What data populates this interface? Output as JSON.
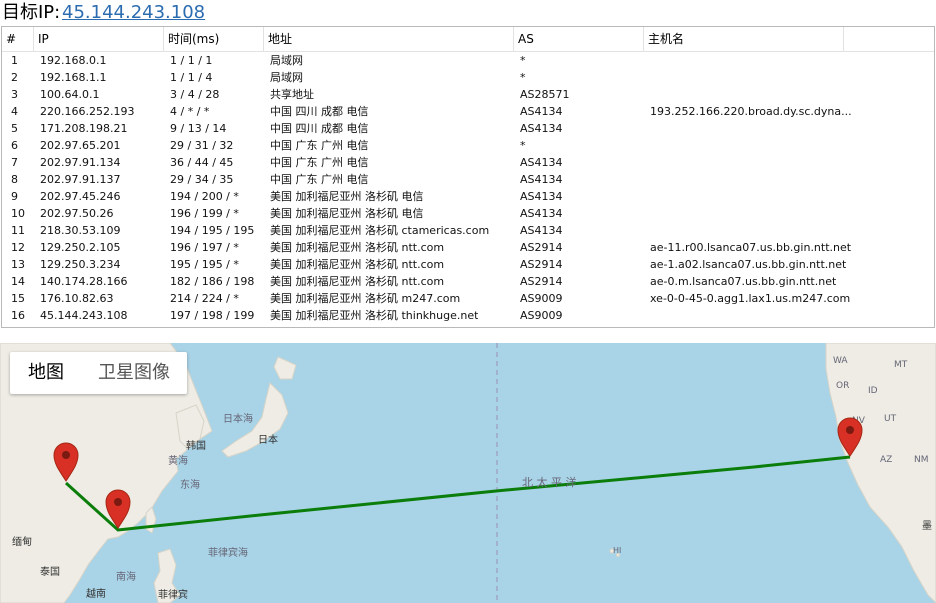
{
  "header": {
    "label": "目标IP:",
    "ip": "45.144.243.108"
  },
  "table": {
    "columns": [
      "#",
      "IP",
      "时间(ms)",
      "地址",
      "AS",
      "主机名"
    ],
    "rows": [
      [
        "1",
        "192.168.0.1",
        "1 / 1 / 1",
        "局域网",
        "*",
        ""
      ],
      [
        "2",
        "192.168.1.1",
        "1 / 1 / 4",
        "局域网",
        "*",
        ""
      ],
      [
        "3",
        "100.64.0.1",
        "3 / 4 / 28",
        "共享地址",
        "AS28571",
        ""
      ],
      [
        "4",
        "220.166.252.193",
        "4 / * / *",
        "中国 四川 成都 电信",
        "AS4134",
        "193.252.166.220.broad.dy.sc.dyna..."
      ],
      [
        "5",
        "171.208.198.21",
        "9 / 13 / 14",
        "中国 四川 成都 电信",
        "AS4134",
        ""
      ],
      [
        "6",
        "202.97.65.201",
        "29 / 31 / 32",
        "中国 广东 广州 电信",
        "*",
        ""
      ],
      [
        "7",
        "202.97.91.134",
        "36 / 44 / 45",
        "中国 广东 广州 电信",
        "AS4134",
        ""
      ],
      [
        "8",
        "202.97.91.137",
        "29 / 34 / 35",
        "中国 广东 广州 电信",
        "AS4134",
        ""
      ],
      [
        "9",
        "202.97.45.246",
        "194 / 200 / *",
        "美国 加利福尼亚州 洛杉矶 电信",
        "AS4134",
        ""
      ],
      [
        "10",
        "202.97.50.26",
        "196 / 199 / *",
        "美国 加利福尼亚州 洛杉矶 电信",
        "AS4134",
        ""
      ],
      [
        "11",
        "218.30.53.109",
        "194 / 195 / 195",
        "美国 加利福尼亚州 洛杉矶 ctamericas.com",
        "AS4134",
        ""
      ],
      [
        "12",
        "129.250.2.105",
        "196 / 197 / *",
        "美国 加利福尼亚州 洛杉矶 ntt.com",
        "AS2914",
        "ae-11.r00.lsanca07.us.bb.gin.ntt.net"
      ],
      [
        "13",
        "129.250.3.234",
        "195 / 195 / *",
        "美国 加利福尼亚州 洛杉矶 ntt.com",
        "AS2914",
        "ae-1.a02.lsanca07.us.bb.gin.ntt.net"
      ],
      [
        "14",
        "140.174.28.166",
        "182 / 186 / 198",
        "美国 加利福尼亚州 洛杉矶 ntt.com",
        "AS2914",
        "ae-0.m.lsanca07.us.bb.gin.ntt.net"
      ],
      [
        "15",
        "176.10.82.63",
        "214 / 224 / *",
        "美国 加利福尼亚州 洛杉矶 m247.com",
        "AS9009",
        "xe-0-0-45-0.agg1.lax1.us.m247.com"
      ],
      [
        "16",
        "45.144.243.108",
        "197 / 198 / 199",
        "美国 加利福尼亚州 洛杉矶 thinkhuge.net",
        "AS9009",
        ""
      ]
    ]
  },
  "map": {
    "type_controls": {
      "map": "地图",
      "satellite": "卫星图像"
    },
    "labels": {
      "japan_sea": "日本海",
      "japan": "日本",
      "korea": "韩国",
      "yellow_sea": "黄海",
      "east_sea": "东海",
      "philippine_sea": "菲律宾海",
      "myanmar": "缅甸",
      "thailand": "泰国",
      "south_sea": "南海",
      "philippines": "菲律宾",
      "vietnam": "越南",
      "pacific": "北 太 平 洋",
      "hawaii": "HI",
      "wa": "WA",
      "mt": "MT",
      "or": "OR",
      "id": "ID",
      "nv": "NV",
      "az": "AZ",
      "ut": "UT",
      "nm": "NM",
      "mexico": "墨"
    },
    "colors": {
      "water": "#a9d3e6",
      "land": "#eeece4",
      "route": "#0a7d0a",
      "pin": "#d93025"
    }
  }
}
